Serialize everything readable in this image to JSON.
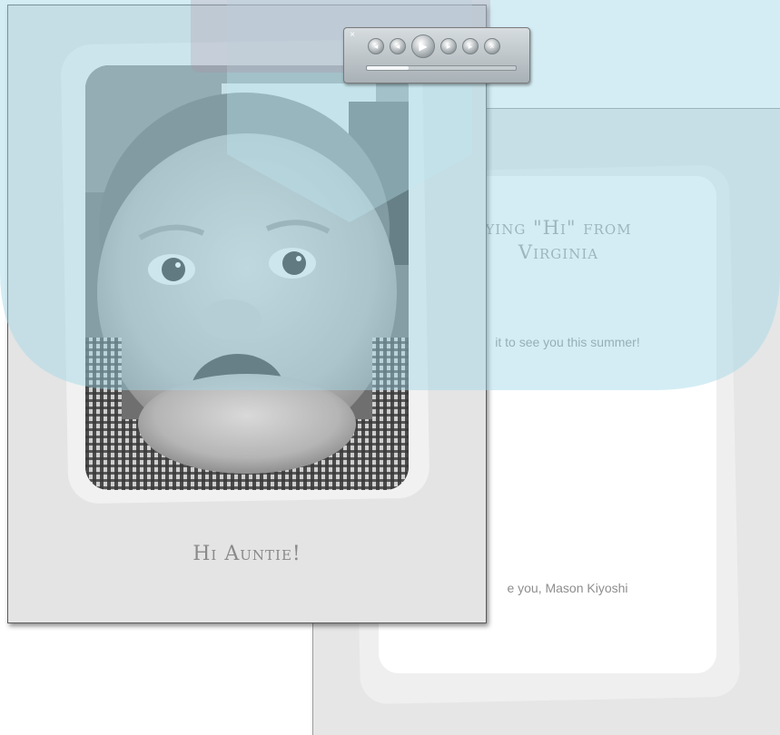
{
  "front_card": {
    "caption": "Hi Auntie!"
  },
  "back_card": {
    "heading_line1": "ying \"Hi\" from",
    "heading_line2": "Virginia",
    "message": "it to see you this summer!",
    "signoff": "e you, Mason Kiyoshi"
  },
  "media_bar": {
    "close_glyph": "×",
    "buttons": [
      {
        "name": "rewind-icon",
        "glyph": "◂"
      },
      {
        "name": "previous-icon",
        "glyph": "◂"
      },
      {
        "name": "play-icon",
        "glyph": "▶"
      },
      {
        "name": "next-icon",
        "glyph": "▸"
      },
      {
        "name": "forward-icon",
        "glyph": "▸"
      },
      {
        "name": "stop-icon",
        "glyph": "×"
      }
    ],
    "progress": 0.28
  },
  "colors": {
    "watermark": "#9fd8e6",
    "card_background": "#e4e4e4",
    "text_gray": "#8a8a8a"
  }
}
